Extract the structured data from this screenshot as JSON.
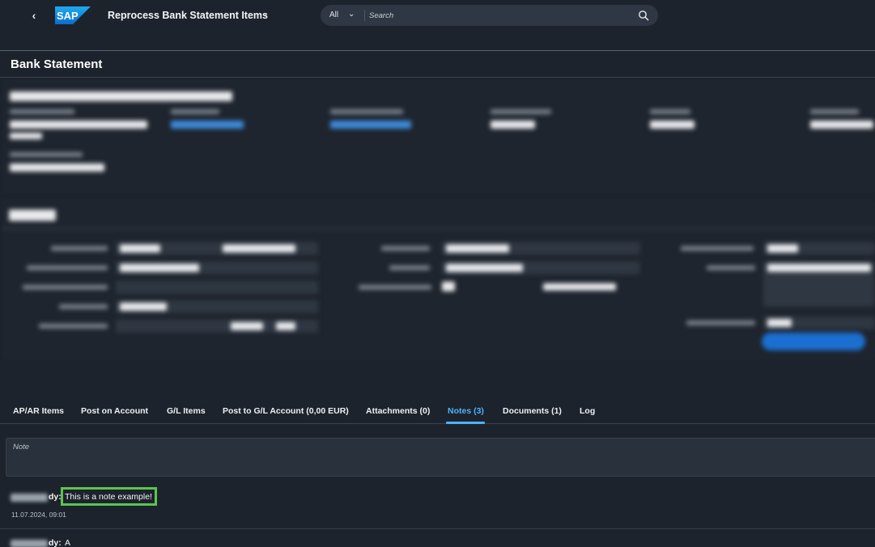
{
  "shell": {
    "app_title": "Reprocess Bank Statement Items",
    "title_caret": "⌄",
    "search": {
      "category": "All",
      "placeholder": "Search"
    }
  },
  "object": {
    "title": "Bank Statement"
  },
  "tabs": [
    {
      "label": "AP/AR Items",
      "active": false
    },
    {
      "label": "Post on Account",
      "active": false
    },
    {
      "label": "G/L Items",
      "active": false
    },
    {
      "label": "Post to G/L Account (0,00 EUR)",
      "active": false
    },
    {
      "label": "Attachments (0)",
      "active": false
    },
    {
      "label": "Notes (3)",
      "active": true
    },
    {
      "label": "Documents (1)",
      "active": false
    },
    {
      "label": "Log",
      "active": false
    }
  ],
  "notes": {
    "input_placeholder": "Note",
    "items": [
      {
        "author_suffix": "dy:",
        "text": "This is a note example!",
        "date": "11.07.2024, 09:01",
        "highlighted": true
      },
      {
        "author_suffix": "dy:",
        "text": "A",
        "date": "",
        "highlighted": false
      }
    ]
  },
  "colors": {
    "accent": "#4db1ff",
    "highlight": "#5cc550",
    "shell_bg": "#1d232c",
    "brand": "#1a8cff"
  }
}
